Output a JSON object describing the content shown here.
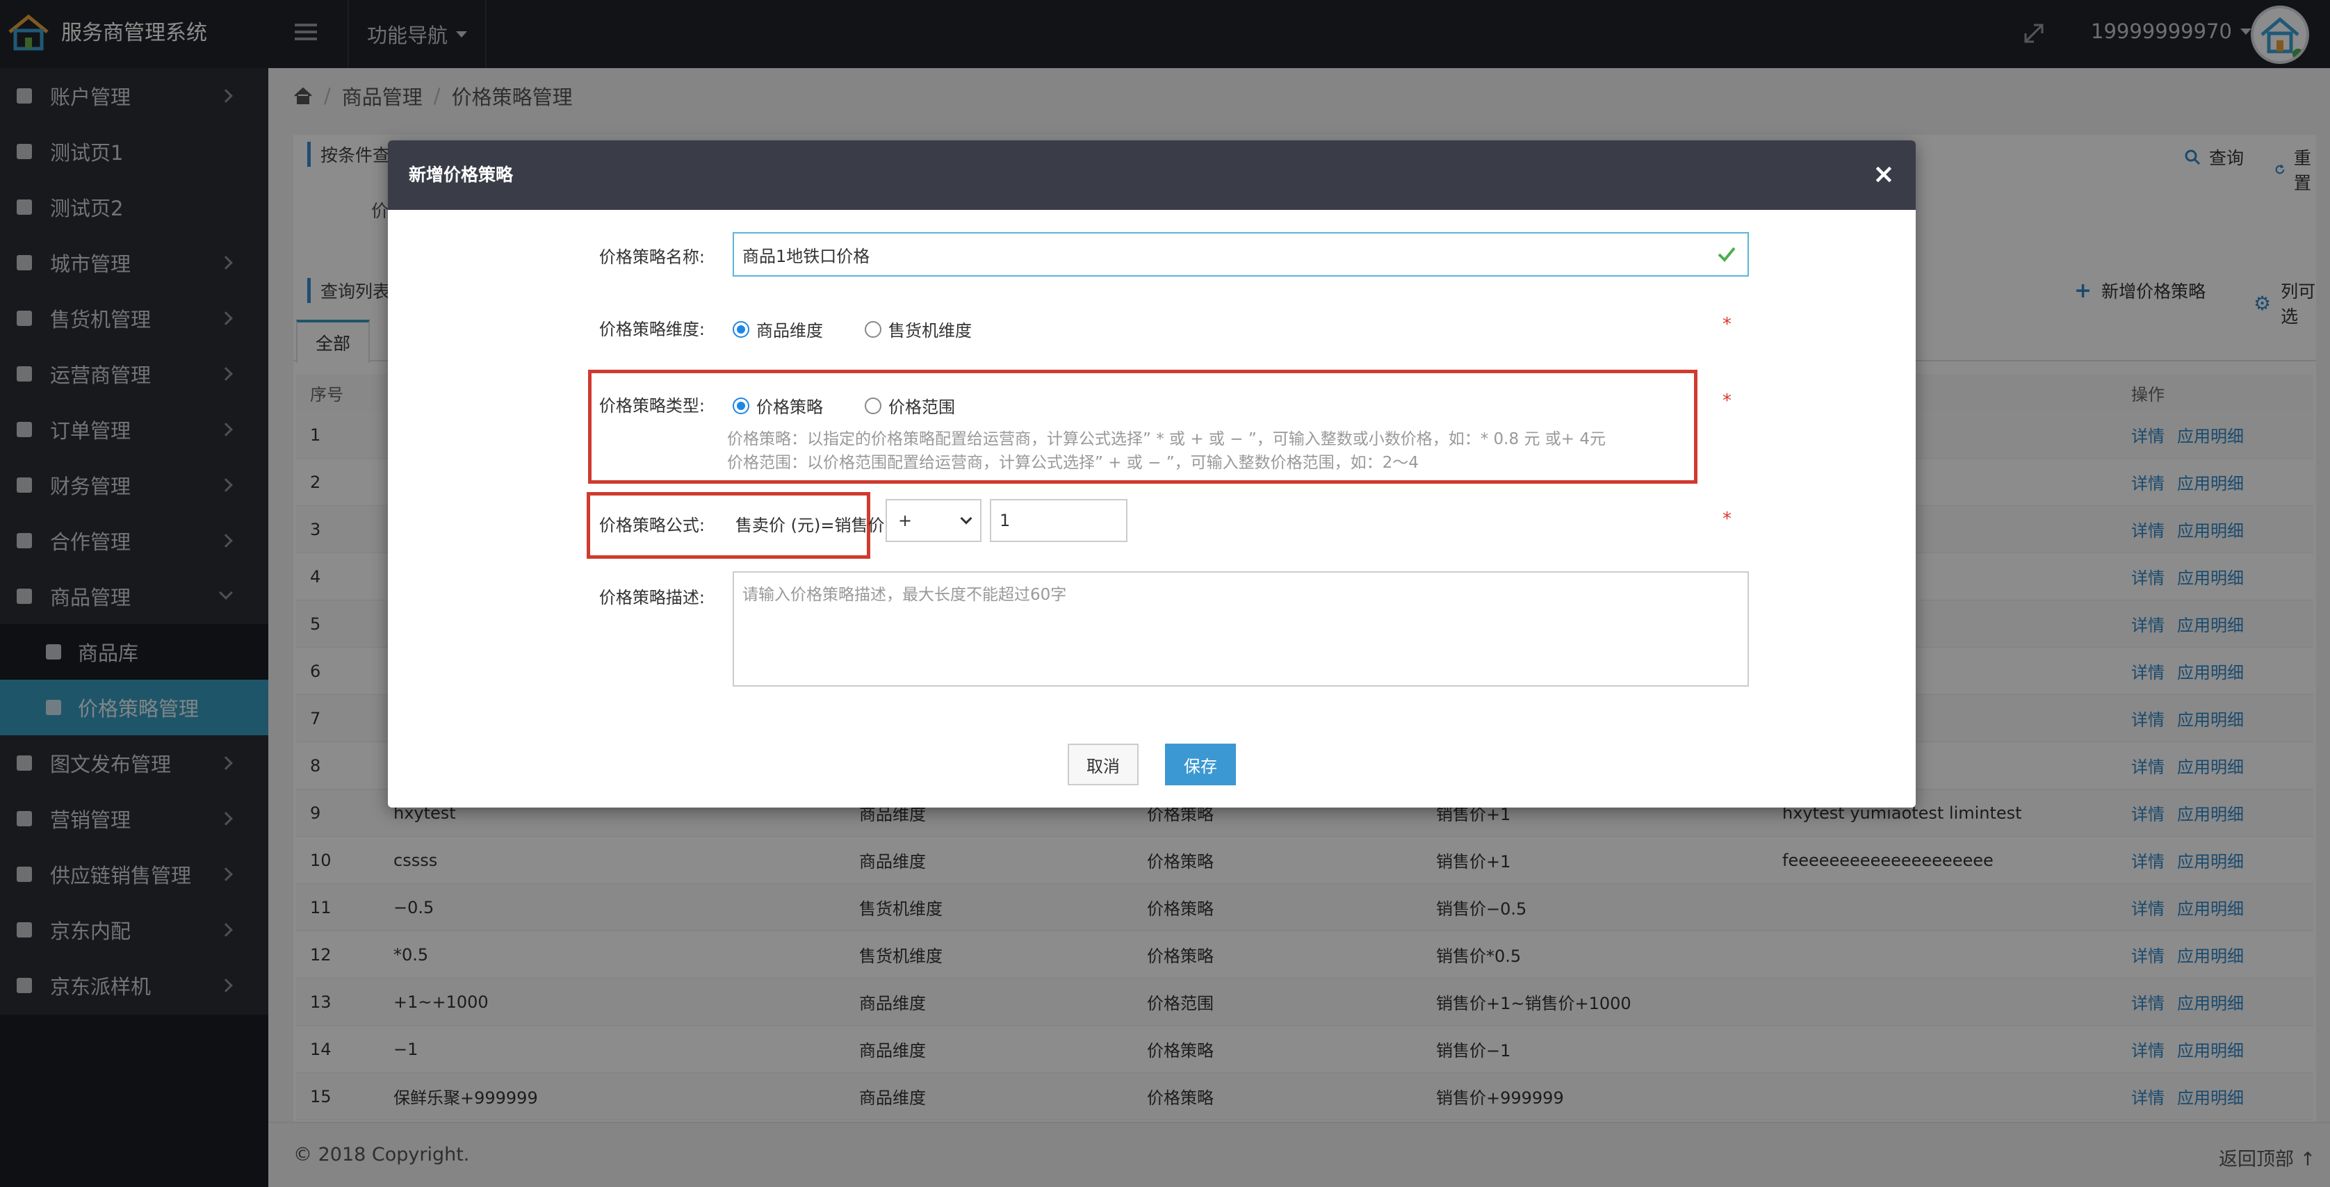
{
  "header": {
    "app_title": "服务商管理系统",
    "func_nav": "功能导航",
    "user": "19999999970"
  },
  "sidebar": {
    "items": [
      {
        "label": "账户管理"
      },
      {
        "label": "测试页1"
      },
      {
        "label": "测试页2"
      },
      {
        "label": "城市管理"
      },
      {
        "label": "售货机管理"
      },
      {
        "label": "运营商管理"
      },
      {
        "label": "订单管理"
      },
      {
        "label": "财务管理"
      },
      {
        "label": "合作管理"
      },
      {
        "label": "商品管理"
      },
      {
        "label": "商品库"
      },
      {
        "label": "价格策略管理"
      },
      {
        "label": "图文发布管理"
      },
      {
        "label": "营销管理"
      },
      {
        "label": "供应链销售管理"
      },
      {
        "label": "京东内配"
      },
      {
        "label": "京东派样机"
      }
    ]
  },
  "breadcrumb": {
    "l1": "商品管理",
    "l2": "价格策略管理"
  },
  "condition": {
    "title": "按条件查询",
    "label": "价格",
    "search": "查询",
    "reset": "重置"
  },
  "list": {
    "title": "查询列表",
    "add": "新增价格策略",
    "columns": "列可选",
    "tab_all": "全部",
    "headers": {
      "seq": "序号",
      "op": "操作"
    },
    "rows": [
      {
        "seq": "1",
        "name": "",
        "dim": "",
        "type": "",
        "formula": "",
        "desc": ""
      },
      {
        "seq": "2",
        "name": "",
        "dim": "",
        "type": "",
        "formula": "",
        "desc": ""
      },
      {
        "seq": "3",
        "name": "",
        "dim": "",
        "type": "",
        "formula": "",
        "desc": ""
      },
      {
        "seq": "4",
        "name": "",
        "dim": "",
        "type": "",
        "formula": "",
        "desc": ""
      },
      {
        "seq": "5",
        "name": "",
        "dim": "",
        "type": "",
        "formula": "",
        "desc": ""
      },
      {
        "seq": "6",
        "name": "",
        "dim": "",
        "type": "",
        "formula": "",
        "desc": ""
      },
      {
        "seq": "7",
        "name": "",
        "dim": "",
        "type": "",
        "formula": "",
        "desc": ""
      },
      {
        "seq": "8",
        "name": "",
        "dim": "",
        "type": "",
        "formula": "",
        "desc": ""
      },
      {
        "seq": "9",
        "name": "hxytest",
        "dim": "商品维度",
        "type": "价格策略",
        "formula": "销售价+1",
        "desc": "hxytest yumiaotest limintest"
      },
      {
        "seq": "10",
        "name": "cssss",
        "dim": "商品维度",
        "type": "价格策略",
        "formula": "销售价+1",
        "desc": "feeeeeeeeeeeeeeeeeeee"
      },
      {
        "seq": "11",
        "name": "−0.5",
        "dim": "售货机维度",
        "type": "价格策略",
        "formula": "销售价−0.5",
        "desc": ""
      },
      {
        "seq": "12",
        "name": "*0.5",
        "dim": "售货机维度",
        "type": "价格策略",
        "formula": "销售价*0.5",
        "desc": ""
      },
      {
        "seq": "13",
        "name": "+1~+1000",
        "dim": "商品维度",
        "type": "价格范围",
        "formula": "销售价+1~销售价+1000",
        "desc": ""
      },
      {
        "seq": "14",
        "name": "−1",
        "dim": "商品维度",
        "type": "价格策略",
        "formula": "销售价−1",
        "desc": ""
      },
      {
        "seq": "15",
        "name": "保鲜乐聚+999999",
        "dim": "商品维度",
        "type": "价格策略",
        "formula": "销售价+999999",
        "desc": ""
      }
    ],
    "op_detail": "详情",
    "op_apply": "应用明细"
  },
  "footer": {
    "copyright": "© 2018 Copyright.",
    "back_top": "返回顶部"
  },
  "modal": {
    "title": "新增价格策略",
    "close": "×",
    "name_label": "价格策略名称:",
    "name_value": "商品1地铁口价格",
    "dim_label": "价格策略维度:",
    "dim_opt1": "商品维度",
    "dim_opt2": "售货机维度",
    "type_label": "价格策略类型:",
    "type_opt1": "价格策略",
    "type_opt2": "价格范围",
    "hint1": "价格策略：以指定的价格策略配置给运营商，计算公式选择” * 或 + 或 − ”，可输入整数或小数价格，如：* 0.8 元 或+ 4元",
    "hint2": "价格范围：以价格范围配置给运营商，计算公式选择” + 或 − ”，可输入整数价格范围，如：2〜4",
    "formula_label": "价格策略公式:",
    "formula_prefix": "售卖价 (元)=销售价",
    "formula_op": "+",
    "formula_value": "1",
    "desc_label": "价格策略描述:",
    "desc_placeholder": "请输入价格策略描述，最大长度不能超过60字",
    "required": "*",
    "cancel": "取消",
    "save": "保存"
  },
  "colors": {
    "accent": "#3a9cc0",
    "highlight_box": "#d03a2f",
    "save_button": "#3b98d2"
  }
}
